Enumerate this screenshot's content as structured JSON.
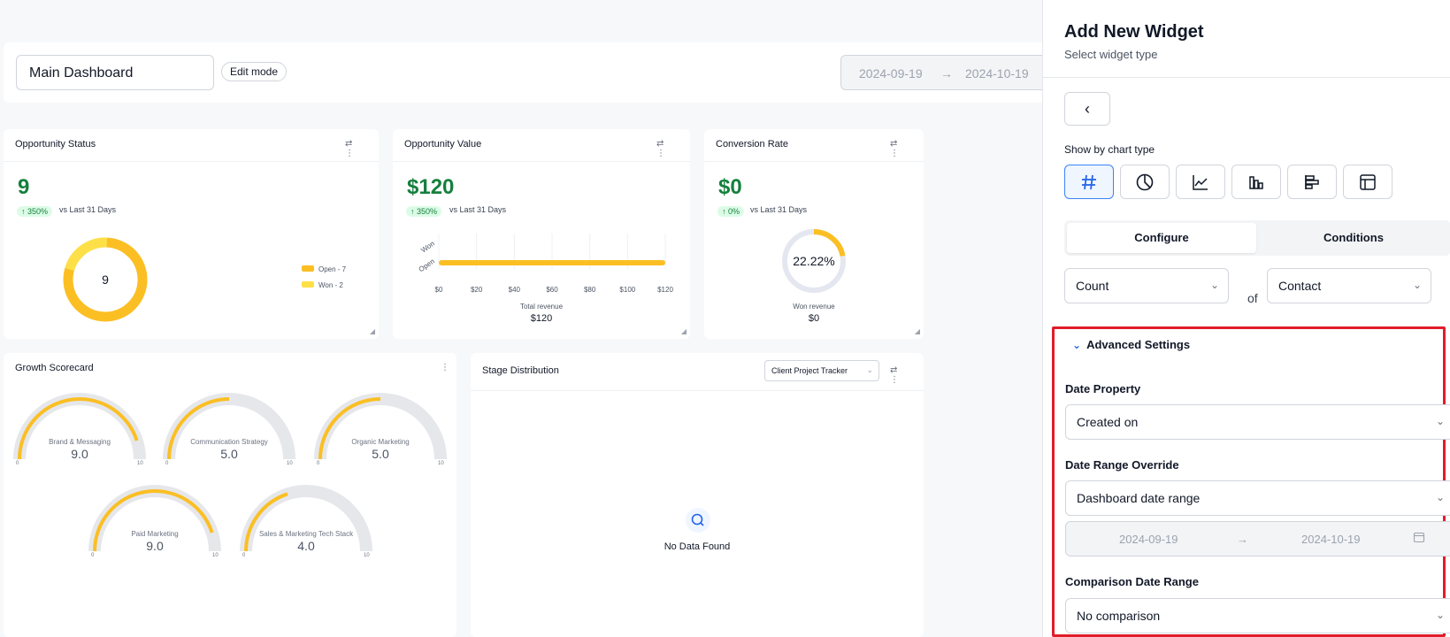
{
  "header": {
    "dashboard_name": "Main Dashboard",
    "edit_mode_label": "Edit mode",
    "date_start": "2024-09-19",
    "date_end": "2024-10-19",
    "arrow": "→"
  },
  "widgets": {
    "opportunity_status": {
      "title": "Opportunity Status",
      "value": "9",
      "change": "↑ 350%",
      "vs_text": "vs Last 31 Days",
      "donut_center": "9",
      "legend": [
        {
          "label": "Open - 7",
          "value": 7,
          "color": "#fbbf24"
        },
        {
          "label": "Won - 2",
          "value": 2,
          "color": "#fde047"
        }
      ]
    },
    "opportunity_value": {
      "title": "Opportunity Value",
      "value": "$120",
      "change": "↑ 350%",
      "vs_text": "vs Last 31 Days",
      "footer_label": "Total revenue",
      "footer_value": "$120"
    },
    "conversion_rate": {
      "title": "Conversion Rate",
      "value": "$0",
      "change": "↑ 0%",
      "vs_text": "vs Last 31 Days",
      "gauge_text": "22.22%",
      "gauge_fraction": 0.2222,
      "footer_label": "Won revenue",
      "footer_value": "$0"
    },
    "growth_scorecard": {
      "title": "Growth Scorecard",
      "tick_min": "0",
      "tick_max": "10",
      "gauges": [
        {
          "name": "Brand & Messaging",
          "value": "9.0",
          "level": 9.0
        },
        {
          "name": "Communication Strategy",
          "value": "5.0",
          "level": 5.0
        },
        {
          "name": "Organic Marketing",
          "value": "5.0",
          "level": 5.0
        },
        {
          "name": "Paid Marketing",
          "value": "9.0",
          "level": 9.0
        },
        {
          "name": "Sales & Marketing Tech Stack",
          "value": "4.0",
          "level": 4.0
        }
      ]
    },
    "stage_distribution": {
      "title": "Stage Distribution",
      "pipeline_select": "Client Project Tracker",
      "empty_text": "No Data Found"
    }
  },
  "chart_data": {
    "type": "bar",
    "categories": [
      "Won",
      "Open"
    ],
    "values": [
      0,
      120
    ],
    "xlabel": "Total revenue",
    "x_ticks": [
      "$0",
      "$20",
      "$40",
      "$60",
      "$80",
      "$100",
      "$120"
    ],
    "xlim": [
      0,
      120
    ],
    "grid": true,
    "colors": {
      "bar": "#fbbf24"
    }
  },
  "panel": {
    "title": "Add New Widget",
    "subtitle": "Select widget type",
    "back_icon": "‹",
    "show_by_label": "Show by chart type",
    "chart_types": [
      "number-icon",
      "pie-chart-icon",
      "line-chart-icon",
      "bar-chart-icon",
      "horizontal-bar-icon",
      "table-icon"
    ],
    "tabs": [
      "Configure",
      "Conditions"
    ],
    "aggregate": "Count",
    "of_label": "of",
    "object": "Contact",
    "advanced": {
      "title": "Advanced Settings",
      "date_property_label": "Date Property",
      "date_property_value": "Created on",
      "date_range_label": "Date Range Override",
      "date_range_value": "Dashboard date range",
      "date_start": "2024-09-19",
      "date_end": "2024-10-19",
      "comparison_label": "Comparison Date Range",
      "comparison_value": "No comparison"
    }
  },
  "colors": {
    "accent": "#2563eb",
    "gauge_fill": "#fbbf24",
    "positive": "#15803d",
    "highlight_border": "#e11d2a"
  }
}
